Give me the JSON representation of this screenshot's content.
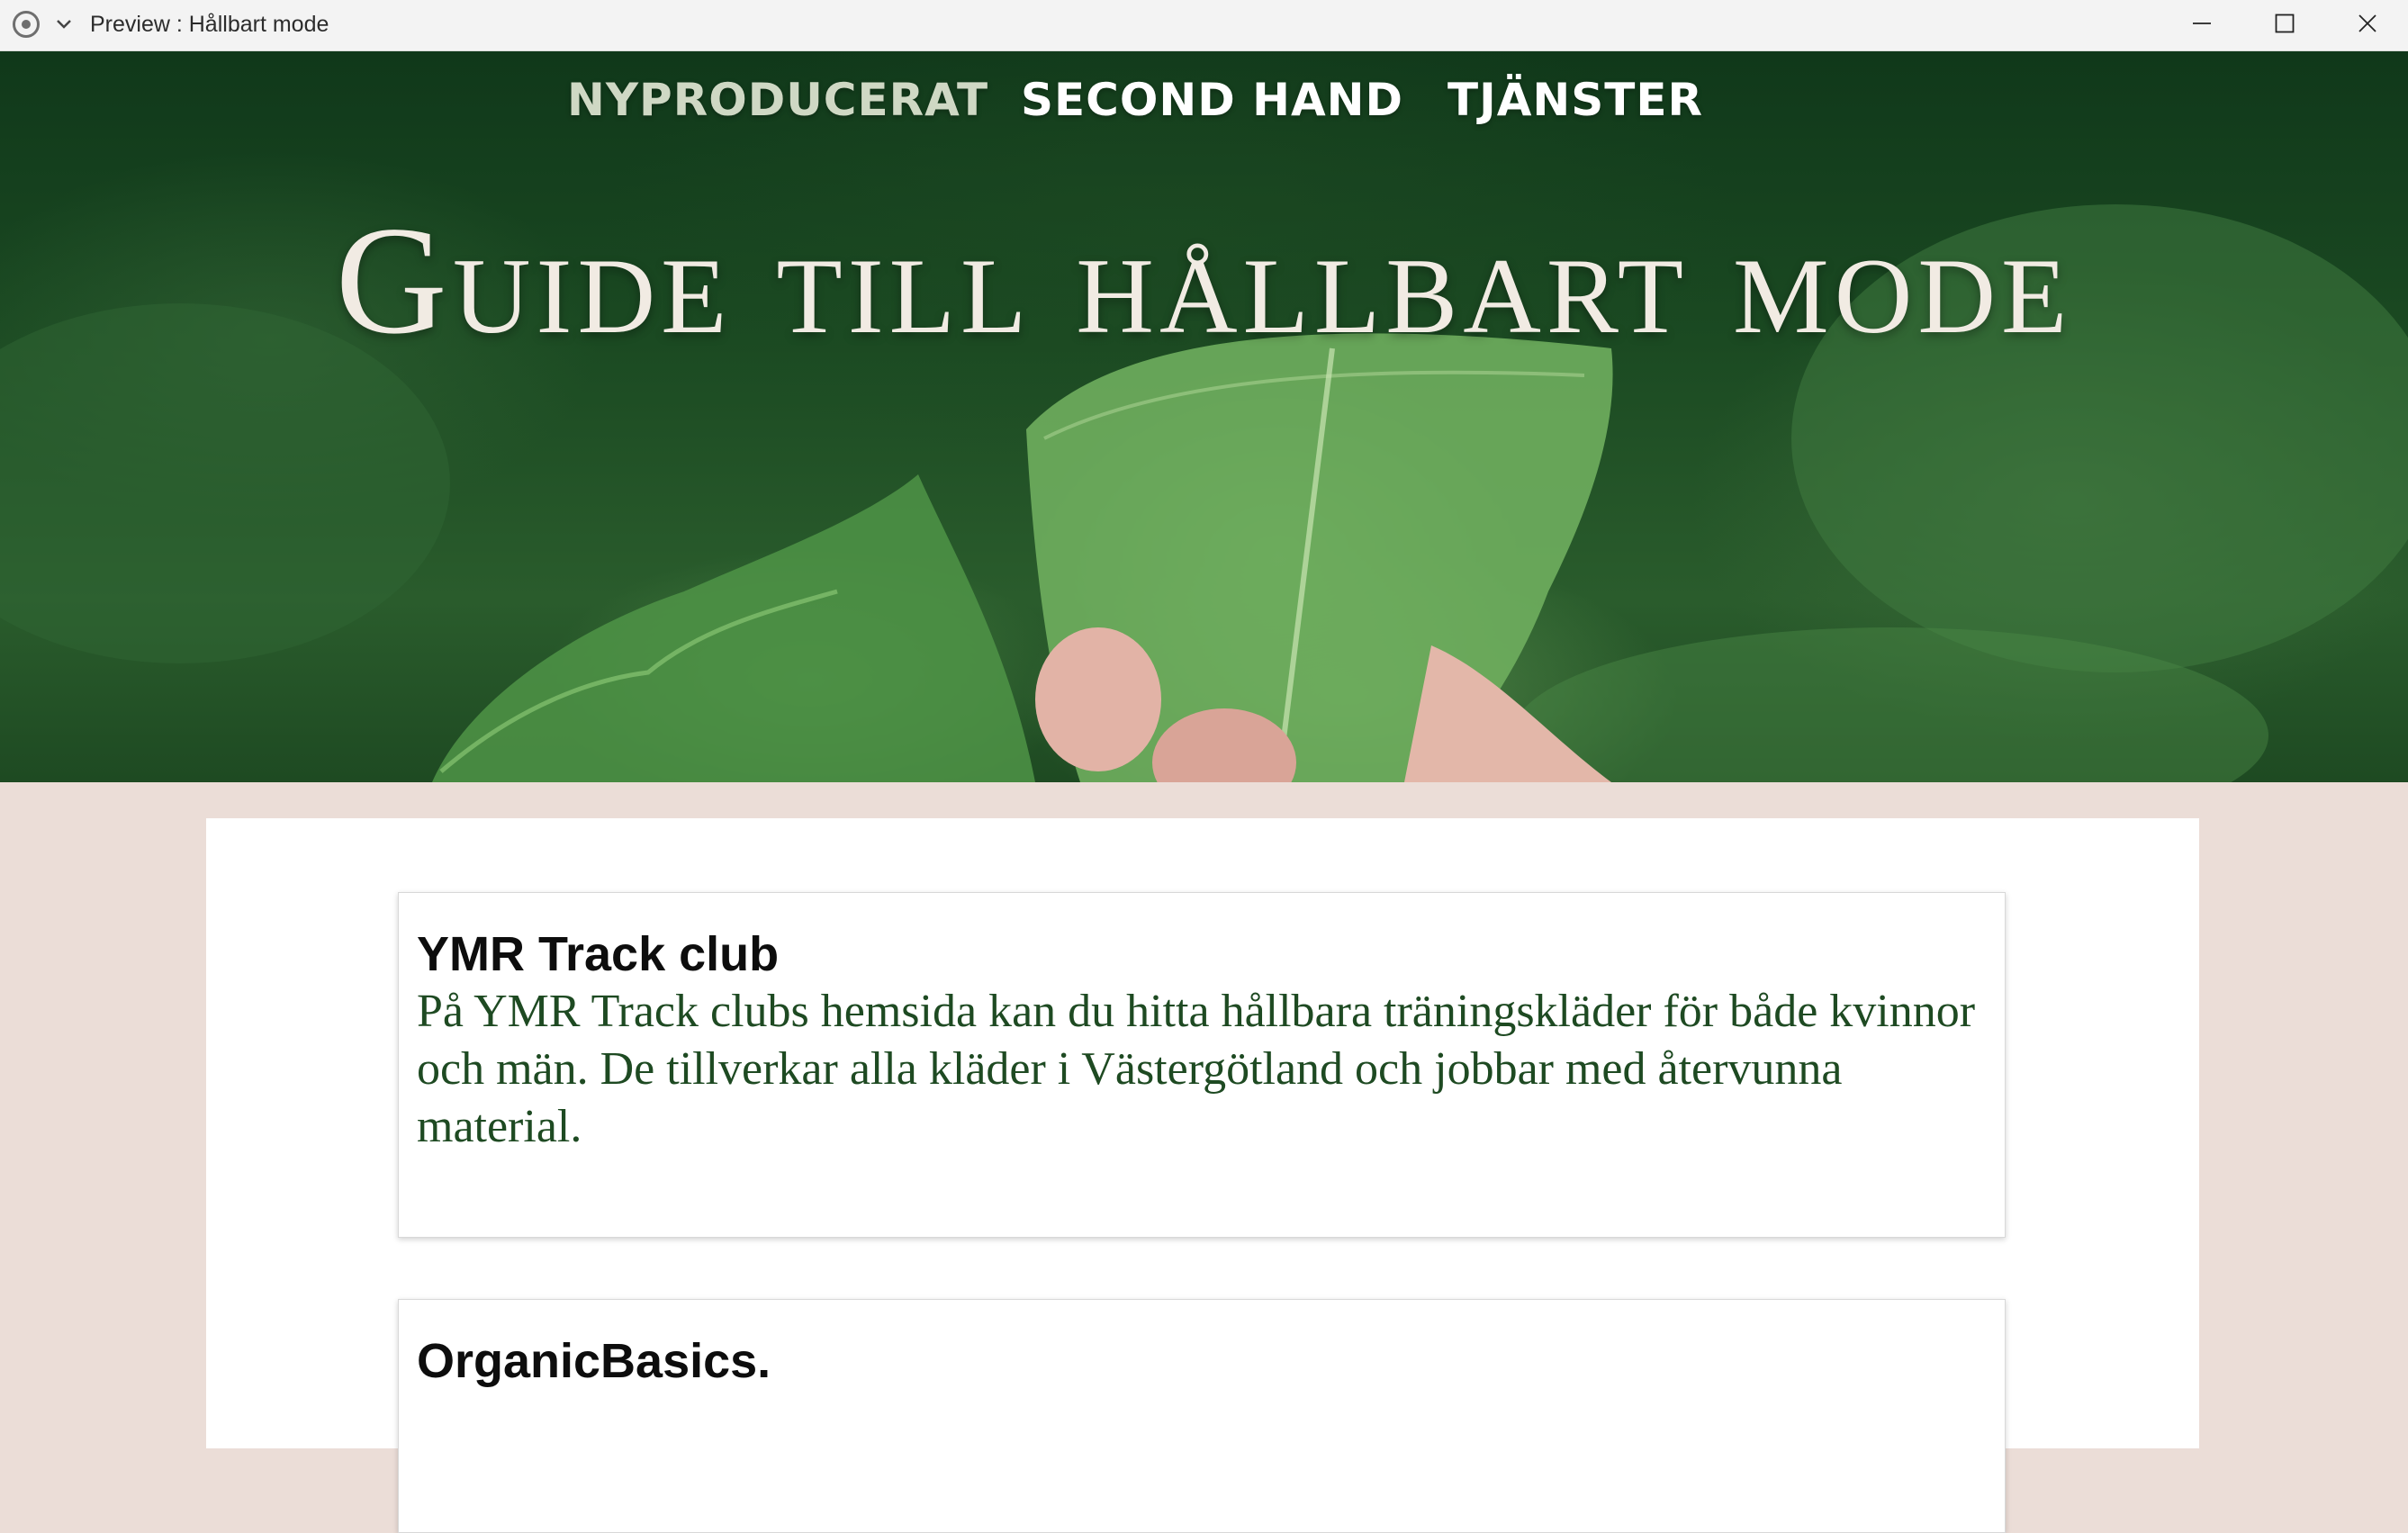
{
  "window": {
    "title": "Preview : Hållbart mode",
    "app_icon": "record-icon",
    "menu_icon": "chevron-down-icon",
    "controls": [
      "minimize-icon",
      "maximize-icon",
      "close-icon"
    ]
  },
  "nav": {
    "items": [
      {
        "label": "NYPRODUCERAT",
        "active": true
      },
      {
        "label": "SECOND HAND",
        "active": false
      },
      {
        "label": "TJÄNSTER",
        "active": false
      }
    ]
  },
  "hero": {
    "title": "Guide till hållbart mode"
  },
  "cards": [
    {
      "title": "YMR Track club",
      "text": "På YMR Track clubs hemsida kan du hitta hållbara träningskläder för både kvinnor och män. De tillverkar alla kläder i Västergötland och jobbar med återvunna material."
    },
    {
      "title": "OrganicBasics.",
      "text": ""
    }
  ],
  "colors": {
    "page_background": "#ebddd7",
    "card_text": "#1e4a22",
    "nav_active": "#cfd8c4",
    "hero_title": "#f1ebe3"
  }
}
